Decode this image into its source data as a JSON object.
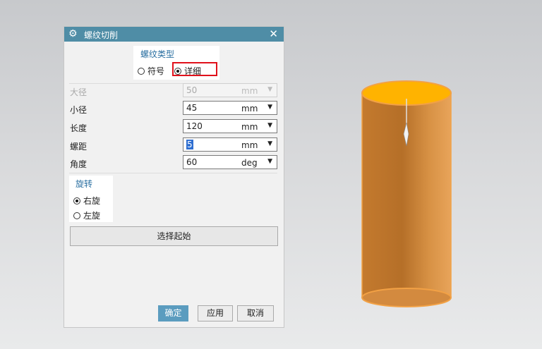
{
  "dialog": {
    "title": "螺纹切削",
    "icons": {
      "title": "gear-icon",
      "close": "close-icon"
    },
    "close_glyph": "✕"
  },
  "thread_type": {
    "title": "螺纹类型",
    "options": [
      {
        "label": "符号",
        "selected": false
      },
      {
        "label": "详细",
        "selected": true
      }
    ]
  },
  "fields": [
    {
      "label": "大径",
      "value": "50",
      "unit": "mm",
      "enabled": false
    },
    {
      "label": "小径",
      "value": "45",
      "unit": "mm",
      "enabled": true
    },
    {
      "label": "长度",
      "value": "120",
      "unit": "mm",
      "enabled": true
    },
    {
      "label": "螺距",
      "value": "5",
      "unit": "mm",
      "enabled": true,
      "focused": true
    },
    {
      "label": "角度",
      "value": "60",
      "unit": "deg",
      "enabled": true
    }
  ],
  "rotation": {
    "title": "旋转",
    "options": [
      {
        "label": "右旋",
        "selected": true
      },
      {
        "label": "左旋",
        "selected": false
      }
    ]
  },
  "select_start_label": "选择起始",
  "footer": {
    "ok": "确定",
    "apply": "应用",
    "cancel": "取消"
  },
  "colors": {
    "titlebar": "#4f8da6",
    "highlight": "#e0111b",
    "cylinder_body": "#d58a3c",
    "cylinder_top": "#ffb300"
  }
}
